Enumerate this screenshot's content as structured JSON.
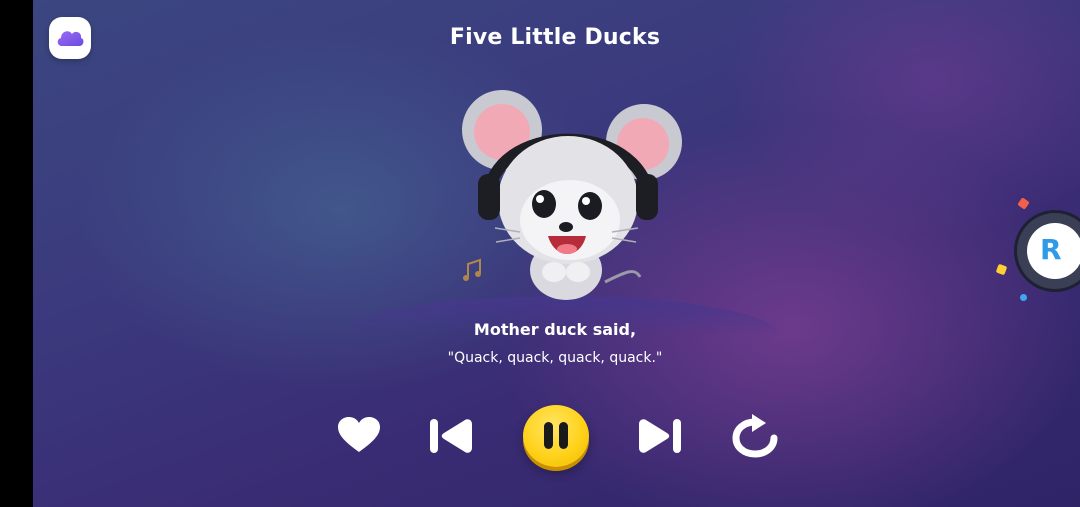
{
  "app": {
    "menu_icon": "cloud-icon",
    "accent_color": "#ffd21a"
  },
  "song": {
    "title": "Five Little Ducks"
  },
  "lyrics": {
    "line1": "Mother duck said,",
    "line2": "\"Quack, quack, quack, quack.\""
  },
  "controls": {
    "favorite_icon": "heart-icon",
    "previous_icon": "skip-previous-icon",
    "play_state": "playing",
    "pause_icon": "pause-icon",
    "next_icon": "skip-next-icon",
    "repeat_icon": "repeat-icon"
  },
  "side_badge": {
    "letter": "R",
    "icon": "reading-badge-icon"
  }
}
